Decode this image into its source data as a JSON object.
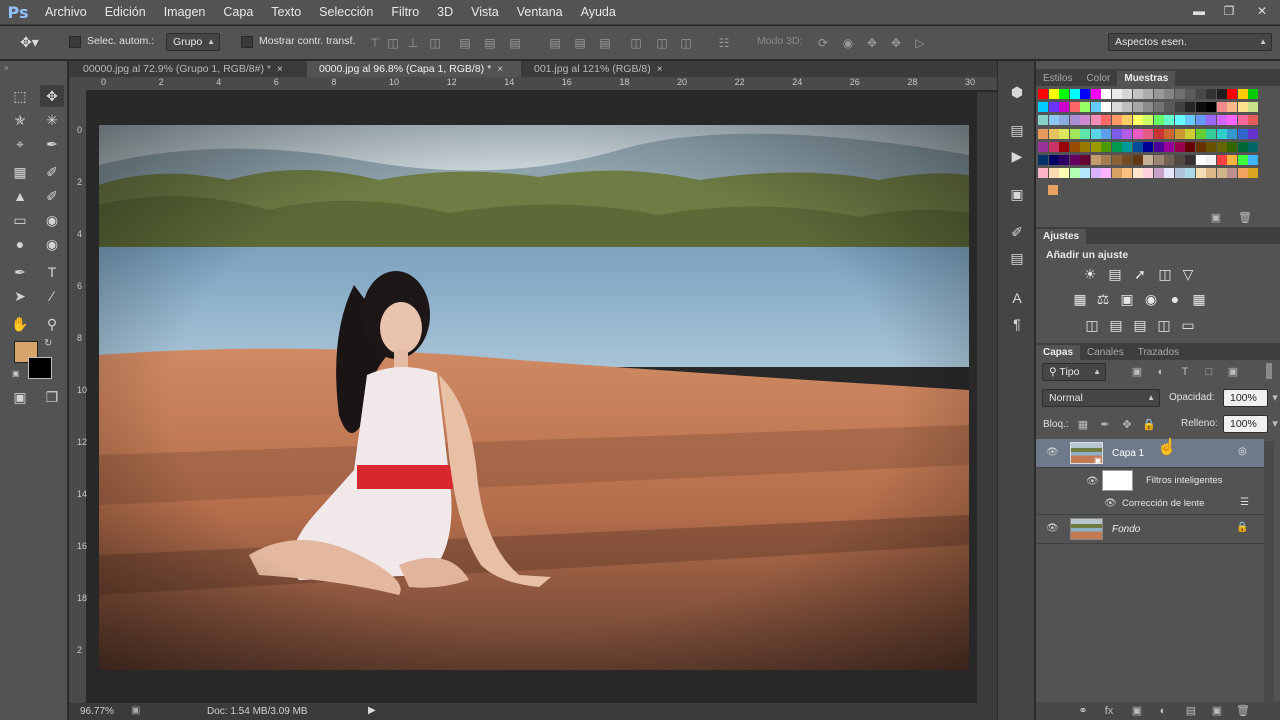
{
  "app": {
    "logo": "Ps"
  },
  "menu": [
    "Archivo",
    "Edición",
    "Imagen",
    "Capa",
    "Texto",
    "Selección",
    "Filtro",
    "3D",
    "Vista",
    "Ventana",
    "Ayuda"
  ],
  "options": {
    "auto_select_label": "Selec. autom.:",
    "auto_select_value": "Grupo",
    "show_transform_label": "Mostrar contr. transf.",
    "mode3d_label": "Modo 3D:",
    "workspace": "Aspectos esen."
  },
  "tabs": [
    {
      "label": "00000.jpg al 72.9% (Grupo 1, RGB/8#) *",
      "active": false
    },
    {
      "label": "0000.jpg al 96.8% (Capa 1, RGB/8) *",
      "active": true
    },
    {
      "label": "001.jpg al 121% (RGB/8)",
      "active": false
    }
  ],
  "ruler_h": [
    "0",
    "2",
    "4",
    "6",
    "8",
    "10",
    "12",
    "14",
    "16",
    "18",
    "20",
    "22",
    "24",
    "26",
    "28",
    "30"
  ],
  "ruler_v": [
    "0",
    "2",
    "4",
    "6",
    "8",
    "10",
    "12",
    "14",
    "16",
    "18",
    "2"
  ],
  "status": {
    "zoom": "96.77%",
    "doc": "Doc: 1.54 MB/3.09 MB"
  },
  "colors": {
    "foreground": "#d8a56a",
    "background": "#000000"
  },
  "swatches_panel": {
    "tabs": [
      "Estilos",
      "Color",
      "Muestras"
    ],
    "active": "Muestras"
  },
  "adjustments_panel": {
    "tab": "Ajustes",
    "title": "Añadir un ajuste"
  },
  "layers_panel": {
    "tabs": [
      "Capas",
      "Canales",
      "Trazados"
    ],
    "active": "Capas",
    "filter_kind": "Tipo",
    "blend_mode": "Normal",
    "opacity_label": "Opacidad:",
    "opacity": "100%",
    "lock_label": "Bloq.:",
    "fill_label": "Relleno:",
    "fill": "100%",
    "layers": [
      {
        "name": "Capa 1",
        "selected": true
      },
      {
        "name": "Filtros inteligentes"
      },
      {
        "name": "Corrección de lente"
      },
      {
        "name": "Fondo",
        "italic": true
      }
    ]
  }
}
